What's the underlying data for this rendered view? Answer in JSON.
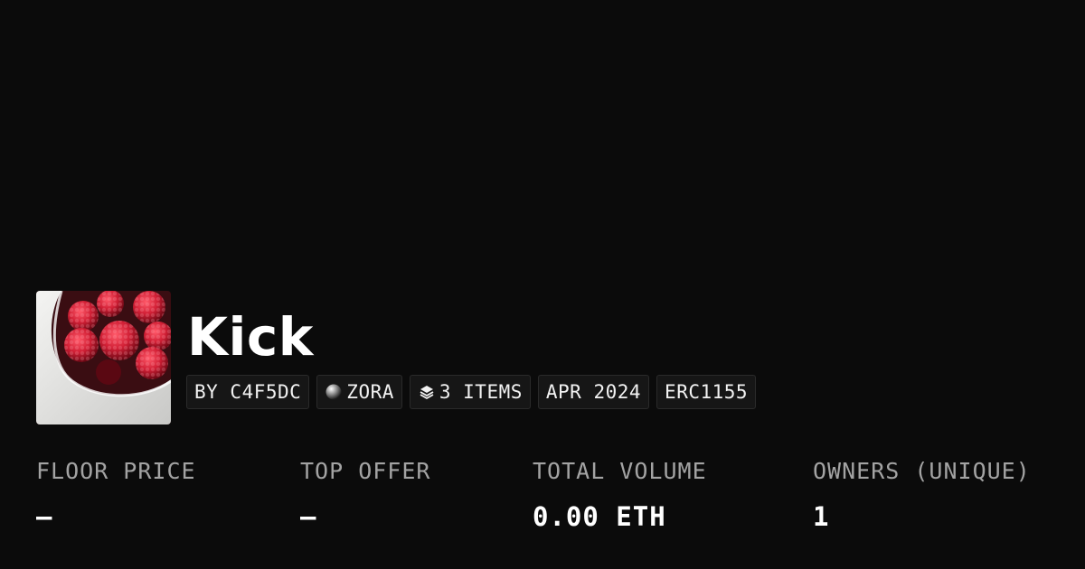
{
  "collection": {
    "title": "Kick",
    "thumbnail_icon": "raspberries-bowl-image"
  },
  "tags": [
    {
      "label": "BY C4F5DC",
      "icon": ""
    },
    {
      "label": "ZORA",
      "icon": "zora-orb-icon"
    },
    {
      "label": "3 ITEMS",
      "icon": "layers-icon"
    },
    {
      "label": "APR 2024",
      "icon": ""
    },
    {
      "label": "ERC1155",
      "icon": ""
    }
  ],
  "stats": {
    "floor_price": {
      "label": "FLOOR PRICE",
      "value": "–"
    },
    "top_offer": {
      "label": "TOP OFFER",
      "value": "–"
    },
    "total_volume": {
      "label": "TOTAL VOLUME",
      "value": "0.00 ETH"
    },
    "owners": {
      "label": "OWNERS (UNIQUE)",
      "value": "1"
    }
  },
  "colors": {
    "background": "#0b0b0b",
    "chip_background": "#161616",
    "label_gray": "#a3a3a3",
    "text": "#ffffff"
  }
}
